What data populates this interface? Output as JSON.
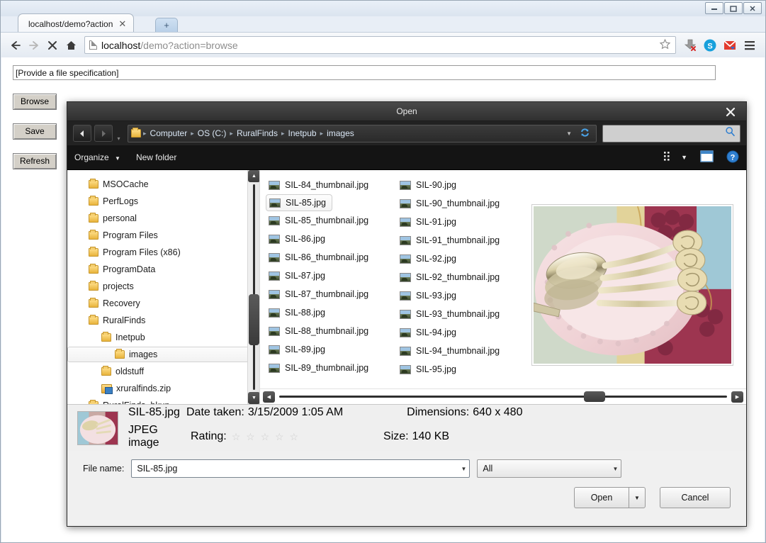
{
  "browser": {
    "tab_title": "localhost/demo?action",
    "tab_close": "✕",
    "new_tab": "+",
    "url_bold": "localhost",
    "url_rest": "/demo?action=browse",
    "window_controls": {
      "minimize": "—",
      "maximize": "▢",
      "close": "✕"
    },
    "icons": [
      "back-arrow",
      "forward-arrow",
      "stop-x",
      "home",
      "bookmark-star",
      "download",
      "skype",
      "gmail",
      "menu"
    ]
  },
  "page": {
    "file_spec_value": "[Provide a file specification]",
    "buttons": [
      "Browse",
      "Save",
      "Refresh"
    ]
  },
  "dialog": {
    "title": "Open",
    "close_label": "✕",
    "nav": {
      "back": "◀",
      "forward": "▶",
      "recent": "▾",
      "refresh": "↻",
      "caret": "▼"
    },
    "breadcrumb": [
      "Computer",
      "OS (C:)",
      "RuralFinds",
      "Inetpub",
      "images"
    ],
    "search_placeholder": "",
    "toolbar": {
      "organize": "Organize",
      "organize_caret": "▼",
      "new_folder": "New folder"
    },
    "tree": [
      {
        "label": "MSOCache",
        "indent": 1,
        "icon": "folder",
        "selected": false
      },
      {
        "label": "PerfLogs",
        "indent": 1,
        "icon": "folder",
        "selected": false
      },
      {
        "label": "personal",
        "indent": 1,
        "icon": "folder",
        "selected": false
      },
      {
        "label": "Program Files",
        "indent": 1,
        "icon": "folder",
        "selected": false
      },
      {
        "label": "Program Files (x86)",
        "indent": 1,
        "icon": "folder",
        "selected": false
      },
      {
        "label": "ProgramData",
        "indent": 1,
        "icon": "folder",
        "selected": false
      },
      {
        "label": "projects",
        "indent": 1,
        "icon": "folder",
        "selected": false
      },
      {
        "label": "Recovery",
        "indent": 1,
        "icon": "folder",
        "selected": false
      },
      {
        "label": "RuralFinds",
        "indent": 1,
        "icon": "folder",
        "selected": false
      },
      {
        "label": "Inetpub",
        "indent": 2,
        "icon": "folder",
        "selected": false
      },
      {
        "label": "images",
        "indent": 3,
        "icon": "folder",
        "selected": true
      },
      {
        "label": "oldstuff",
        "indent": 2,
        "icon": "folder",
        "selected": false
      },
      {
        "label": "xruralfinds.zip",
        "indent": 2,
        "icon": "zip",
        "selected": false
      },
      {
        "label": "RuralFinds_bkup",
        "indent": 1,
        "icon": "folder",
        "selected": false
      }
    ],
    "files_col1": [
      {
        "name": "SIL-84_thumbnail.jpg",
        "selected": false
      },
      {
        "name": "SIL-85.jpg",
        "selected": true
      },
      {
        "name": "SIL-85_thumbnail.jpg",
        "selected": false
      },
      {
        "name": "SIL-86.jpg",
        "selected": false
      },
      {
        "name": "SIL-86_thumbnail.jpg",
        "selected": false
      },
      {
        "name": "SIL-87.jpg",
        "selected": false
      },
      {
        "name": "SIL-87_thumbnail.jpg",
        "selected": false
      },
      {
        "name": "SIL-88.jpg",
        "selected": false
      },
      {
        "name": "SIL-88_thumbnail.jpg",
        "selected": false
      },
      {
        "name": "SIL-89.jpg",
        "selected": false
      },
      {
        "name": "SIL-89_thumbnail.jpg",
        "selected": false
      }
    ],
    "files_col2": [
      {
        "name": "SIL-90.jpg",
        "selected": false
      },
      {
        "name": "SIL-90_thumbnail.jpg",
        "selected": false
      },
      {
        "name": "SIL-91.jpg",
        "selected": false
      },
      {
        "name": "SIL-91_thumbnail.jpg",
        "selected": false
      },
      {
        "name": "SIL-92.jpg",
        "selected": false
      },
      {
        "name": "SIL-92_thumbnail.jpg",
        "selected": false
      },
      {
        "name": "SIL-93.jpg",
        "selected": false
      },
      {
        "name": "SIL-93_thumbnail.jpg",
        "selected": false
      },
      {
        "name": "SIL-94.jpg",
        "selected": false
      },
      {
        "name": "SIL-94_thumbnail.jpg",
        "selected": false
      },
      {
        "name": "SIL-95.jpg",
        "selected": false
      }
    ],
    "details": {
      "filename": "SIL-85.jpg",
      "date_taken_label": "Date taken:",
      "date_taken_value": "3/15/2009 1:05 AM",
      "dimensions_label": "Dimensions:",
      "dimensions_value": "640 x 480",
      "type": "JPEG image",
      "rating_label": "Rating:",
      "rating_stars": "☆ ☆ ☆ ☆ ☆",
      "size_label": "Size:",
      "size_value": "140 KB"
    },
    "footer": {
      "filename_label": "File name:",
      "filename_value": "SIL-85.jpg",
      "filter_value": "All",
      "open_label": "Open",
      "open_caret": "▼",
      "cancel_label": "Cancel"
    }
  }
}
